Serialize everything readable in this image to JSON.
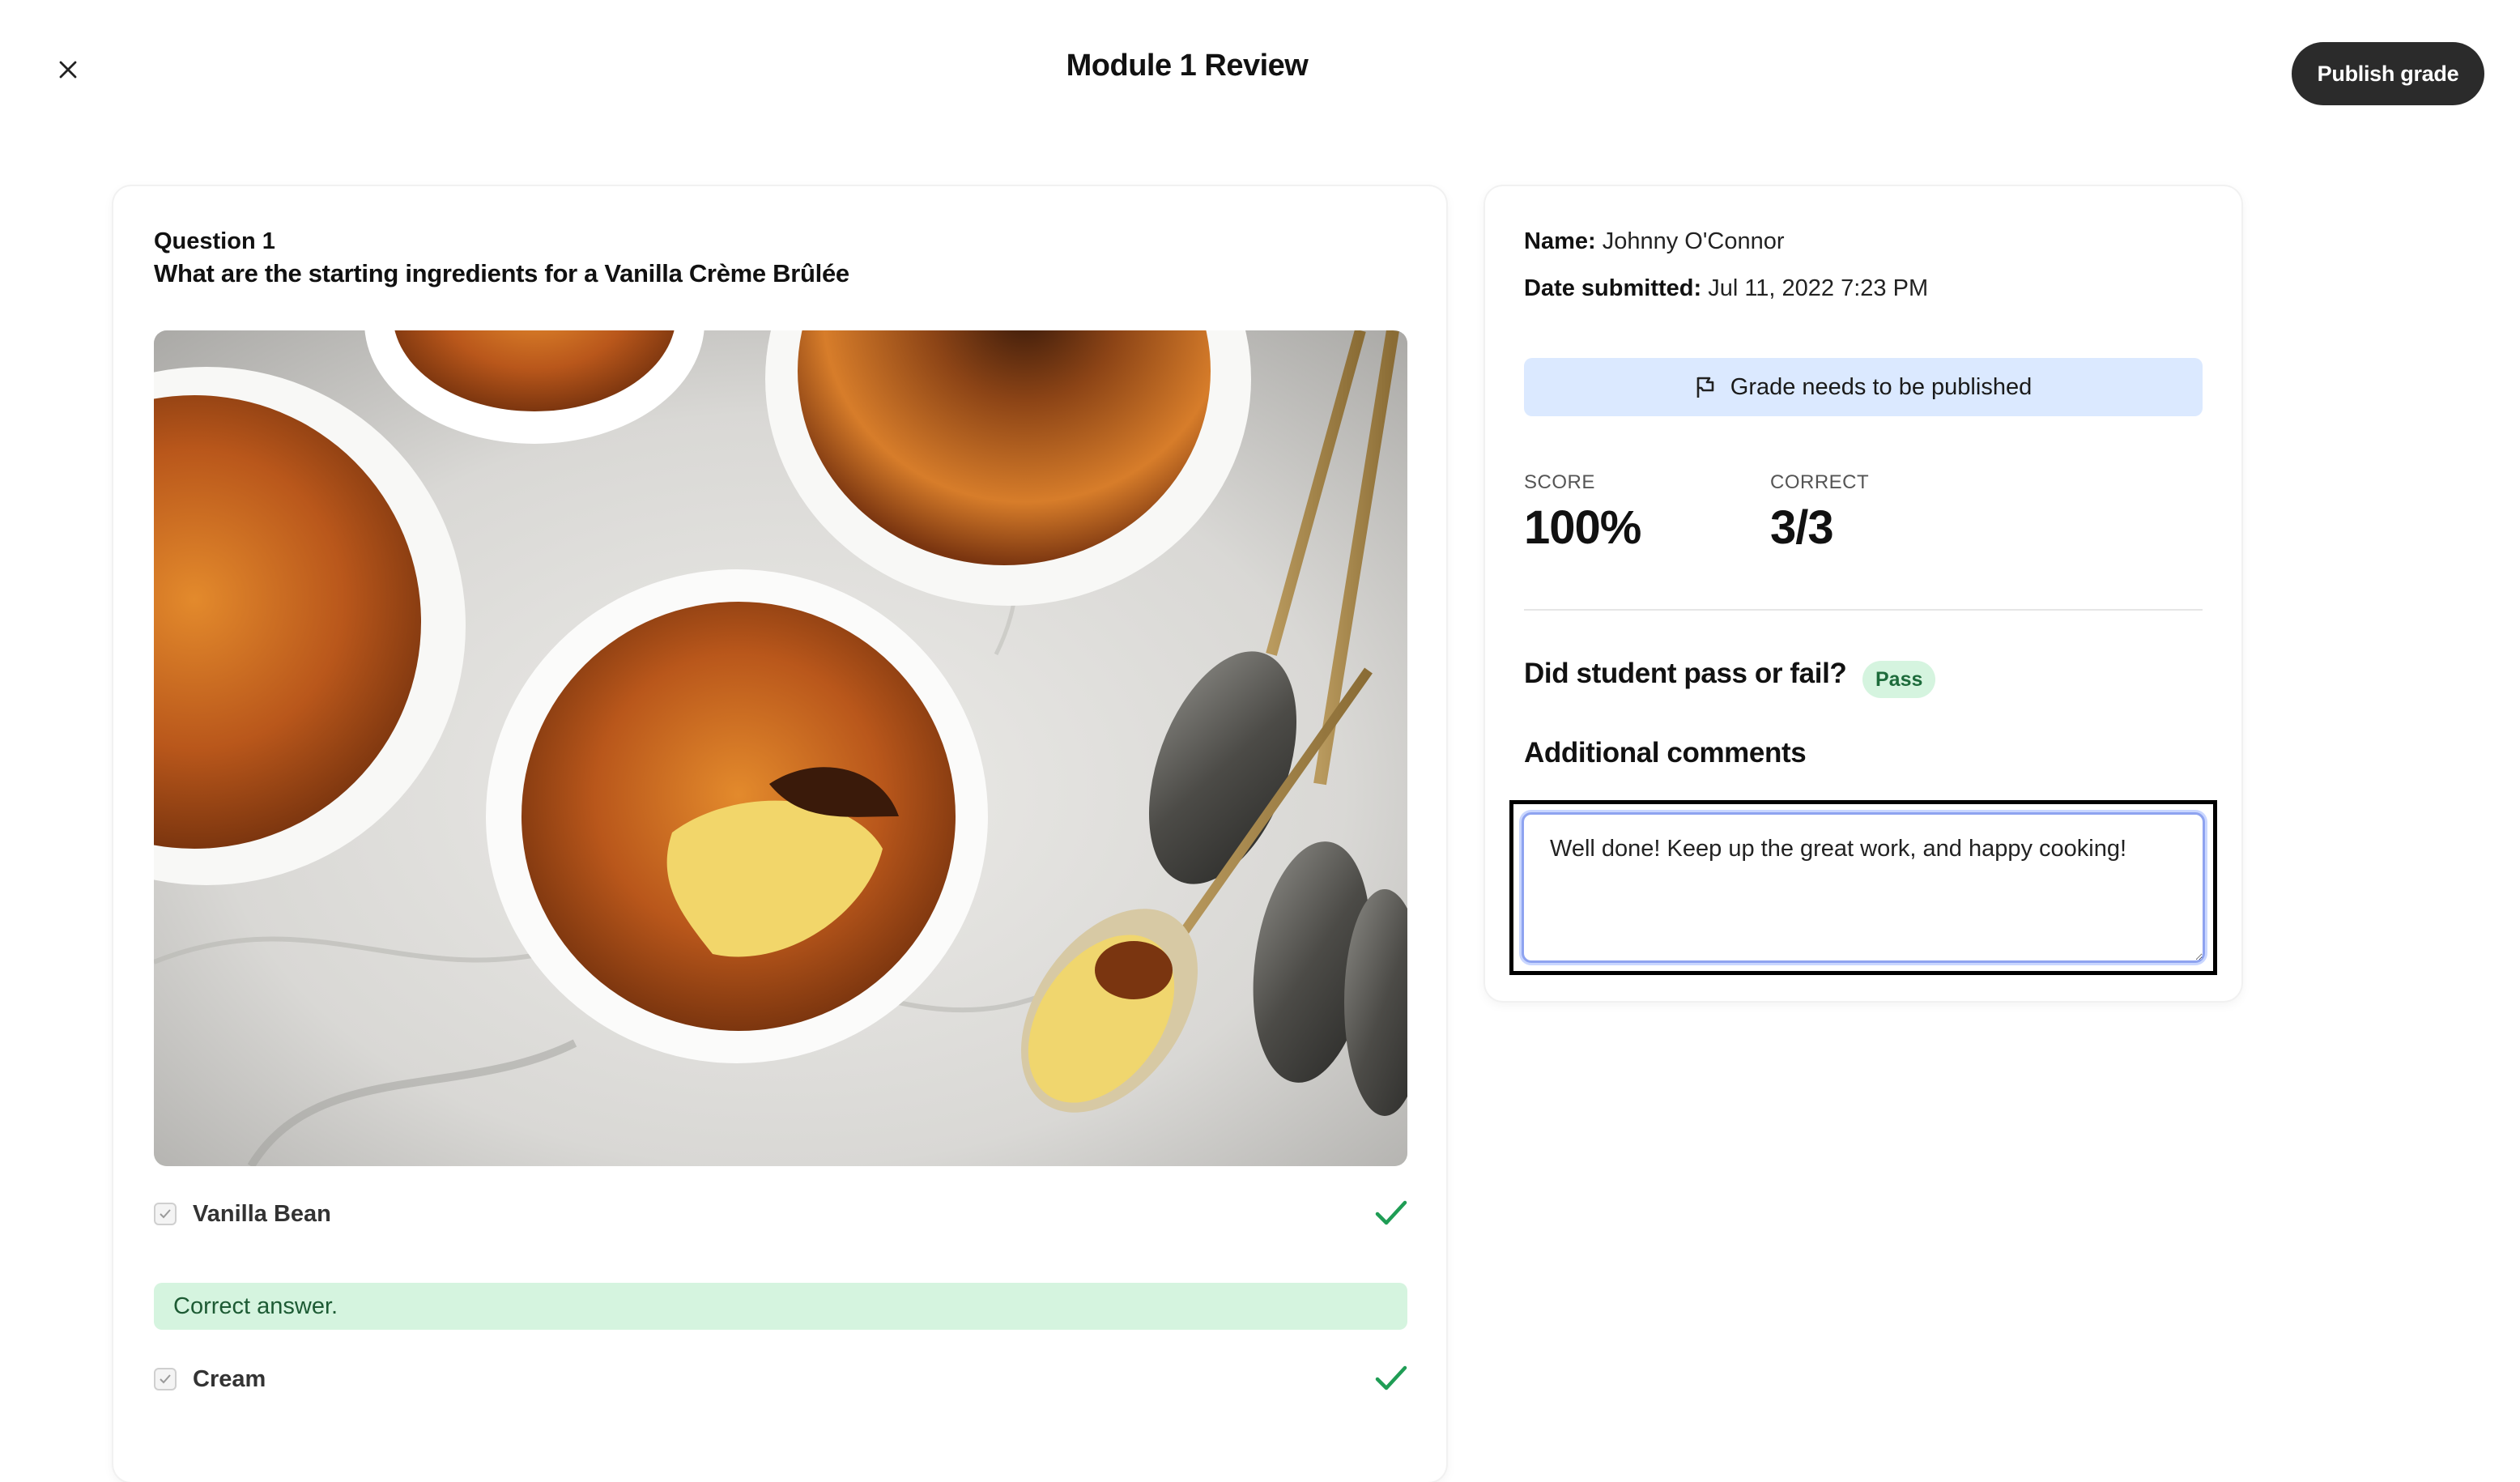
{
  "header": {
    "title": "Module 1 Review",
    "publish_label": "Publish grade",
    "close_icon": "close-icon"
  },
  "question": {
    "number_label": "Question 1",
    "text": "What are the starting ingredients for a Vanilla Crème Brûlée",
    "image_icon": "creme-brulee-photo",
    "answers": [
      {
        "label": "Vanilla Bean",
        "checked": true,
        "correct": true
      },
      {
        "label": "Cream",
        "checked": true,
        "correct": true
      }
    ],
    "feedback": "Correct answer."
  },
  "submission": {
    "name_label": "Name:",
    "name_value": "Johnny O'Connor",
    "date_label": "Date submitted:",
    "date_value": "Jul 11, 2022 7:23 PM",
    "status_text": "Grade needs to be published",
    "status_icon": "flag-icon",
    "score_label": "SCORE",
    "score_value": "100%",
    "correct_label": "CORRECT",
    "correct_value": "3/3",
    "pass_question": "Did student pass or fail?",
    "pass_badge": "Pass",
    "comments_heading": "Additional comments",
    "comments_value": "Well done! Keep up the great work, and happy cooking!"
  },
  "colors": {
    "publish_bg": "#2b2b2b",
    "status_bg": "#dbe9ff",
    "success_bg": "#d5f4df",
    "success_check": "#1f9d55",
    "focus_border": "#8ea3f0"
  }
}
